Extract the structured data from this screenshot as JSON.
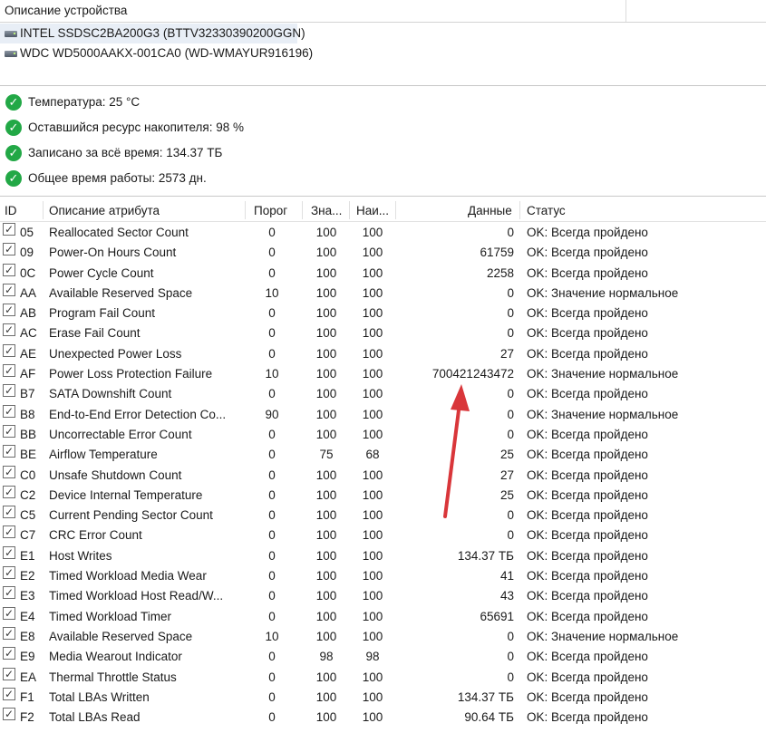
{
  "header": {
    "title": "Описание устройства"
  },
  "devices": [
    {
      "label": "INTEL SSDSC2BA200G3 (BTTV32330390200GGN)",
      "selected": true,
      "icon": "drive-icon"
    },
    {
      "label": "WDC WD5000AAKX-001CA0 (WD-WMAYUR916196)",
      "selected": false,
      "icon": "drive-icon"
    }
  ],
  "summary": [
    {
      "text": "Температура: 25 °C",
      "icon": "check-ok-icon"
    },
    {
      "text": "Оставшийся ресурс накопителя: 98 %",
      "icon": "check-ok-icon"
    },
    {
      "text": "Записано за всё время: 134.37 ТБ",
      "icon": "check-ok-icon"
    },
    {
      "text": "Общее время работы: 2573 дн.",
      "icon": "check-ok-icon"
    }
  ],
  "table": {
    "columns": [
      "ID",
      "Описание атрибута",
      "Порог",
      "Зна...",
      "Наи...",
      "Данные",
      "Статус"
    ],
    "rows": [
      {
        "checked": true,
        "id": "05",
        "desc": "Reallocated Sector Count",
        "thr": "0",
        "val": "100",
        "worst": "100",
        "data": "0",
        "status": "OK: Всегда пройдено"
      },
      {
        "checked": true,
        "id": "09",
        "desc": "Power-On Hours Count",
        "thr": "0",
        "val": "100",
        "worst": "100",
        "data": "61759",
        "status": "OK: Всегда пройдено"
      },
      {
        "checked": true,
        "id": "0C",
        "desc": "Power Cycle Count",
        "thr": "0",
        "val": "100",
        "worst": "100",
        "data": "2258",
        "status": "OK: Всегда пройдено"
      },
      {
        "checked": true,
        "id": "AA",
        "desc": "Available Reserved Space",
        "thr": "10",
        "val": "100",
        "worst": "100",
        "data": "0",
        "status": "OK: Значение нормальное"
      },
      {
        "checked": true,
        "id": "AB",
        "desc": "Program Fail Count",
        "thr": "0",
        "val": "100",
        "worst": "100",
        "data": "0",
        "status": "OK: Всегда пройдено"
      },
      {
        "checked": true,
        "id": "AC",
        "desc": "Erase Fail Count",
        "thr": "0",
        "val": "100",
        "worst": "100",
        "data": "0",
        "status": "OK: Всегда пройдено"
      },
      {
        "checked": true,
        "id": "AE",
        "desc": "Unexpected Power Loss",
        "thr": "0",
        "val": "100",
        "worst": "100",
        "data": "27",
        "status": "OK: Всегда пройдено"
      },
      {
        "checked": true,
        "id": "AF",
        "desc": "Power Loss Protection Failure",
        "thr": "10",
        "val": "100",
        "worst": "100",
        "data": "700421243472",
        "status": "OK: Значение нормальное"
      },
      {
        "checked": true,
        "id": "B7",
        "desc": "SATA Downshift Count",
        "thr": "0",
        "val": "100",
        "worst": "100",
        "data": "0",
        "status": "OK: Всегда пройдено"
      },
      {
        "checked": true,
        "id": "B8",
        "desc": "End-to-End Error Detection Co...",
        "thr": "90",
        "val": "100",
        "worst": "100",
        "data": "0",
        "status": "OK: Значение нормальное"
      },
      {
        "checked": true,
        "id": "BB",
        "desc": "Uncorrectable Error Count",
        "thr": "0",
        "val": "100",
        "worst": "100",
        "data": "0",
        "status": "OK: Всегда пройдено"
      },
      {
        "checked": true,
        "id": "BE",
        "desc": "Airflow Temperature",
        "thr": "0",
        "val": "75",
        "worst": "68",
        "data": "25",
        "status": "OK: Всегда пройдено"
      },
      {
        "checked": true,
        "id": "C0",
        "desc": "Unsafe Shutdown Count",
        "thr": "0",
        "val": "100",
        "worst": "100",
        "data": "27",
        "status": "OK: Всегда пройдено"
      },
      {
        "checked": true,
        "id": "C2",
        "desc": "Device Internal Temperature",
        "thr": "0",
        "val": "100",
        "worst": "100",
        "data": "25",
        "status": "OK: Всегда пройдено"
      },
      {
        "checked": true,
        "id": "C5",
        "desc": "Current Pending Sector Count",
        "thr": "0",
        "val": "100",
        "worst": "100",
        "data": "0",
        "status": "OK: Всегда пройдено"
      },
      {
        "checked": true,
        "id": "C7",
        "desc": "CRC Error Count",
        "thr": "0",
        "val": "100",
        "worst": "100",
        "data": "0",
        "status": "OK: Всегда пройдено"
      },
      {
        "checked": true,
        "id": "E1",
        "desc": "Host Writes",
        "thr": "0",
        "val": "100",
        "worst": "100",
        "data": "134.37 ТБ",
        "status": "OK: Всегда пройдено"
      },
      {
        "checked": true,
        "id": "E2",
        "desc": "Timed Workload Media Wear",
        "thr": "0",
        "val": "100",
        "worst": "100",
        "data": "41",
        "status": "OK: Всегда пройдено"
      },
      {
        "checked": true,
        "id": "E3",
        "desc": "Timed Workload Host Read/W...",
        "thr": "0",
        "val": "100",
        "worst": "100",
        "data": "43",
        "status": "OK: Всегда пройдено"
      },
      {
        "checked": true,
        "id": "E4",
        "desc": "Timed Workload Timer",
        "thr": "0",
        "val": "100",
        "worst": "100",
        "data": "65691",
        "status": "OK: Всегда пройдено"
      },
      {
        "checked": true,
        "id": "E8",
        "desc": "Available Reserved Space",
        "thr": "10",
        "val": "100",
        "worst": "100",
        "data": "0",
        "status": "OK: Значение нормальное"
      },
      {
        "checked": true,
        "id": "E9",
        "desc": "Media Wearout Indicator",
        "thr": "0",
        "val": "98",
        "worst": "98",
        "data": "0",
        "status": "OK: Всегда пройдено"
      },
      {
        "checked": true,
        "id": "EA",
        "desc": "Thermal Throttle Status",
        "thr": "0",
        "val": "100",
        "worst": "100",
        "data": "0",
        "status": "OK: Всегда пройдено"
      },
      {
        "checked": true,
        "id": "F1",
        "desc": "Total LBAs Written",
        "thr": "0",
        "val": "100",
        "worst": "100",
        "data": "134.37 ТБ",
        "status": "OK: Всегда пройдено"
      },
      {
        "checked": true,
        "id": "F2",
        "desc": "Total LBAs Read",
        "thr": "0",
        "val": "100",
        "worst": "100",
        "data": "90.64 ТБ",
        "status": "OK: Всегда пройдено"
      }
    ]
  },
  "annotation": {
    "arrow_color": "#d9363a",
    "icon": "red-arrow-annotation"
  }
}
